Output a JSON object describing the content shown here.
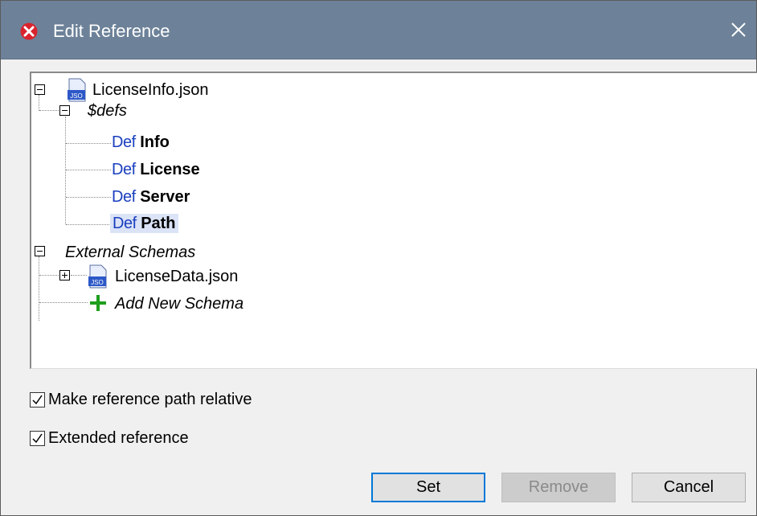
{
  "window": {
    "title": "Edit Reference"
  },
  "tree": {
    "root": {
      "label": "LicenseInfo.json",
      "icon": "json-file-icon"
    },
    "defs": {
      "label": "$defs",
      "items": [
        {
          "prefix": "Def",
          "label": "Info"
        },
        {
          "prefix": "Def",
          "label": "License"
        },
        {
          "prefix": "Def",
          "label": "Server"
        },
        {
          "prefix": "Def",
          "label": "Path",
          "selected": true
        }
      ]
    },
    "external": {
      "label": "External Schemas",
      "items": [
        {
          "label": "LicenseData.json",
          "icon": "json-file-icon"
        }
      ],
      "add_label": "Add New Schema"
    },
    "file_icon_text": "JSO"
  },
  "options": {
    "relative": {
      "label": "Make reference path relative",
      "checked": true
    },
    "extended": {
      "label": "Extended reference",
      "checked": true
    }
  },
  "buttons": {
    "set": "Set",
    "remove": "Remove",
    "cancel": "Cancel"
  },
  "colors": {
    "titlebar": "#6d8299",
    "def_prefix": "#1a3fbf",
    "selection": "#dbe3f7",
    "add_plus": "#1e9e1e",
    "default_button_border": "#0078d7"
  }
}
